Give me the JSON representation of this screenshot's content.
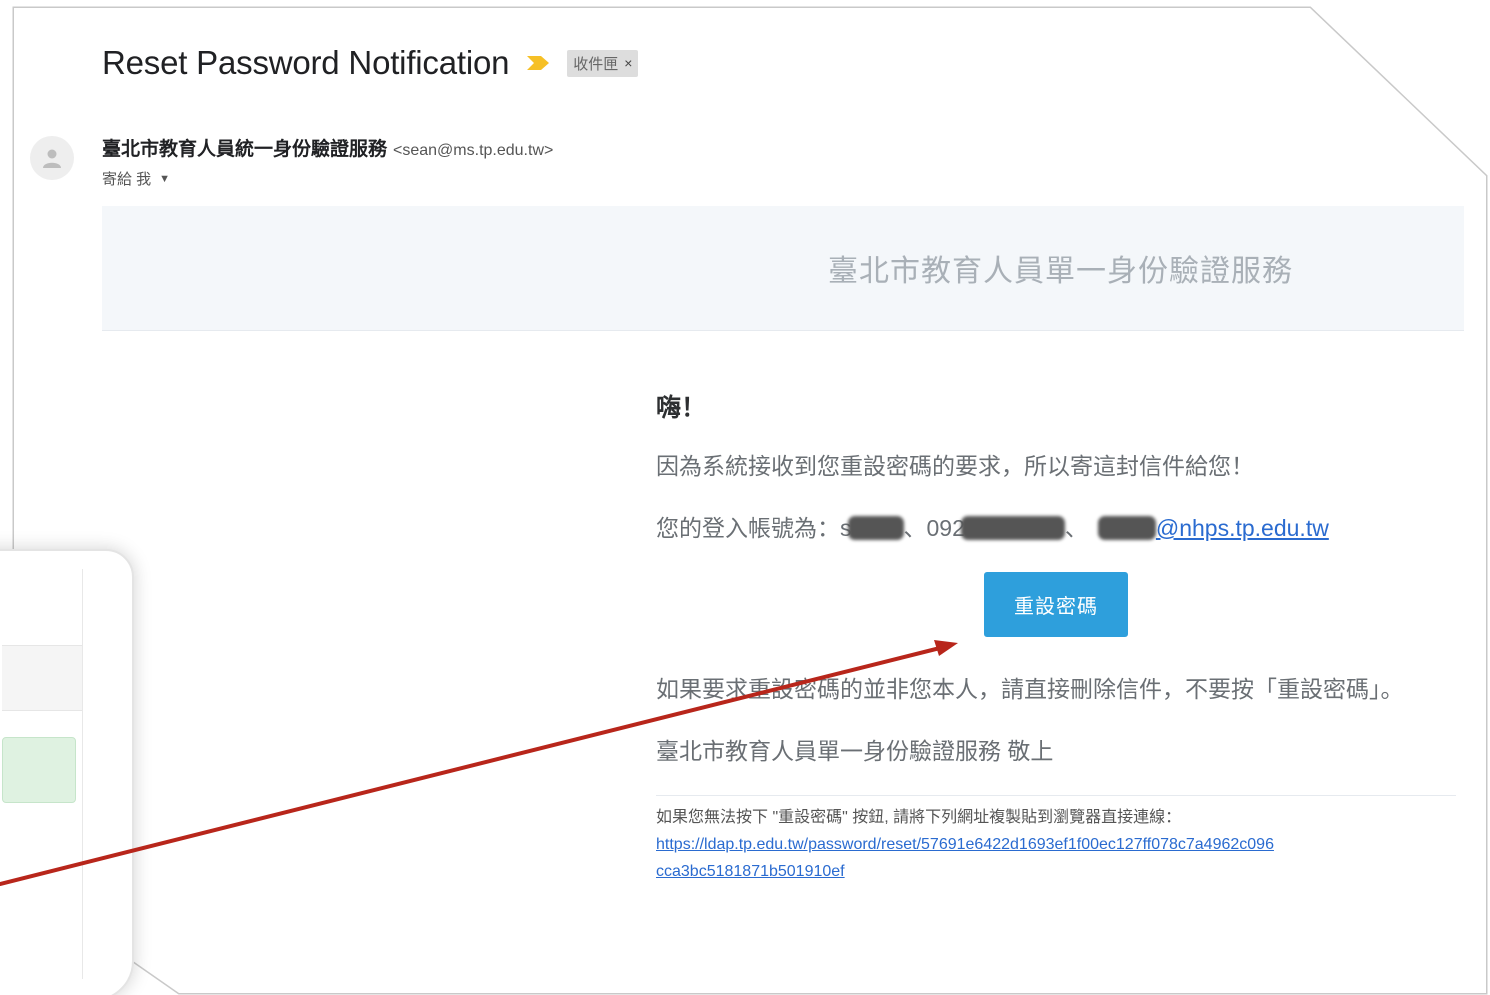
{
  "email": {
    "subject": "Reset Password Notification",
    "label": "收件匣",
    "label_close": "×",
    "sender_name": "臺北市教育人員統一身份驗證服務",
    "sender_email": "<sean@ms.tp.edu.tw>",
    "to_text": "寄給 我",
    "to_caret": "▼"
  },
  "body": {
    "banner_title": "臺北市教育人員單一身份驗證服務",
    "greeting": "嗨！",
    "line1": "因為系統接收到您重設密碼的要求，所以寄這封信件給您！",
    "account_prefix": "您的登入帳號為：s",
    "account_mid": "、092",
    "account_sep": "、",
    "account_email_tail": "@nhps.tp.edu.tw",
    "reset_button": "重設密碼",
    "note": "如果要求重設密碼的並非您本人，請直接刪除信件，不要按「重設密碼」。",
    "signature": "臺北市教育人員單一身份驗證服務 敬上",
    "fallback_text": "如果您無法按下 \"重設密碼\" 按鈕, 請將下列網址複製貼到瀏覽器直接連線：",
    "fallback_link": "https://ldap.tp.edu.tw/password/reset/57691e6422d1693ef1f00ec127ff078c7a4962c096cca3bc5181871b501910ef"
  },
  "colors": {
    "button": "#2e9fdc",
    "link": "#2a6bd0",
    "arrow": "#b8261b",
    "banner": "#f4f7fa",
    "importance": "#f6c026"
  }
}
